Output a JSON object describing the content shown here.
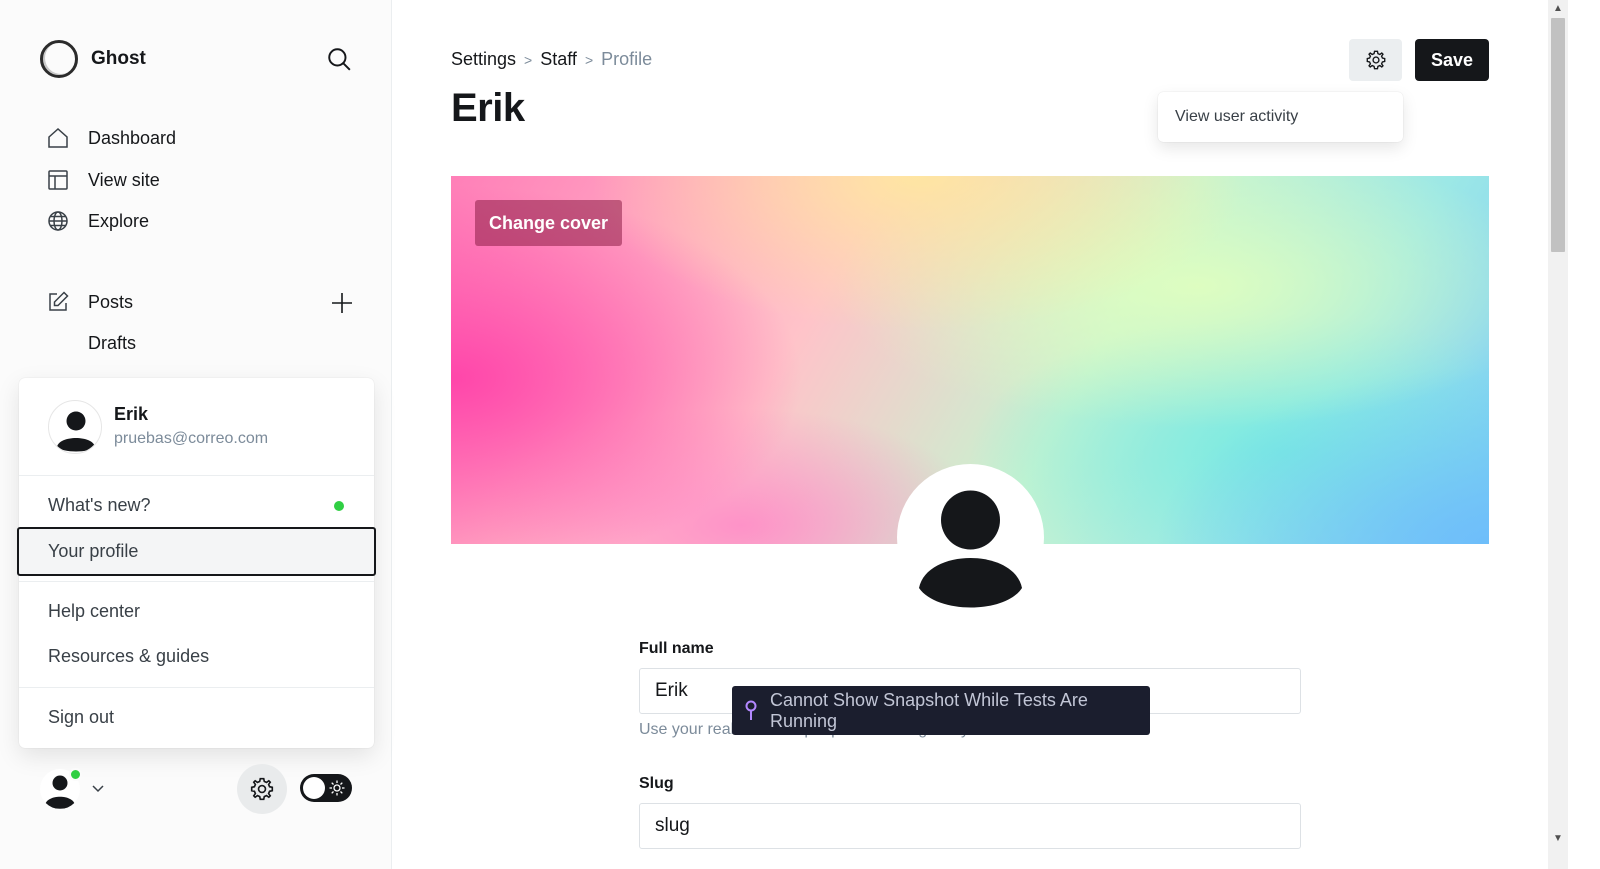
{
  "app": {
    "brand": "Ghost"
  },
  "sidebar": {
    "nav": [
      {
        "label": "Dashboard",
        "icon": "home-icon"
      },
      {
        "label": "View site",
        "icon": "layout-icon"
      },
      {
        "label": "Explore",
        "icon": "globe-icon"
      }
    ],
    "posts": {
      "label": "Posts",
      "icon": "edit-icon",
      "sub": "Drafts"
    }
  },
  "account_menu": {
    "name": "Erik",
    "email": "pruebas@correo.com",
    "items": {
      "whats_new": "What's new?",
      "your_profile": "Your profile",
      "help_center": "Help center",
      "resources": "Resources & guides",
      "sign_out": "Sign out"
    }
  },
  "breadcrumb": {
    "settings": "Settings",
    "staff": "Staff",
    "profile": "Profile",
    "separator": ">"
  },
  "page": {
    "title": "Erik"
  },
  "toolbar": {
    "save_label": "Save",
    "menu_item": "View user activity"
  },
  "cover": {
    "change_label": "Change cover"
  },
  "form": {
    "full_name": {
      "label": "Full name",
      "value": "Erik",
      "hint": "Use your real name so people can recognize you"
    },
    "slug": {
      "label": "Slug",
      "value": "slug"
    }
  },
  "toast": {
    "text": "Cannot Show Snapshot While Tests Are Running"
  },
  "colors": {
    "accent_green": "#30cf43",
    "primary_dark": "#15171a",
    "toast_bg": "#1b1e2e"
  }
}
